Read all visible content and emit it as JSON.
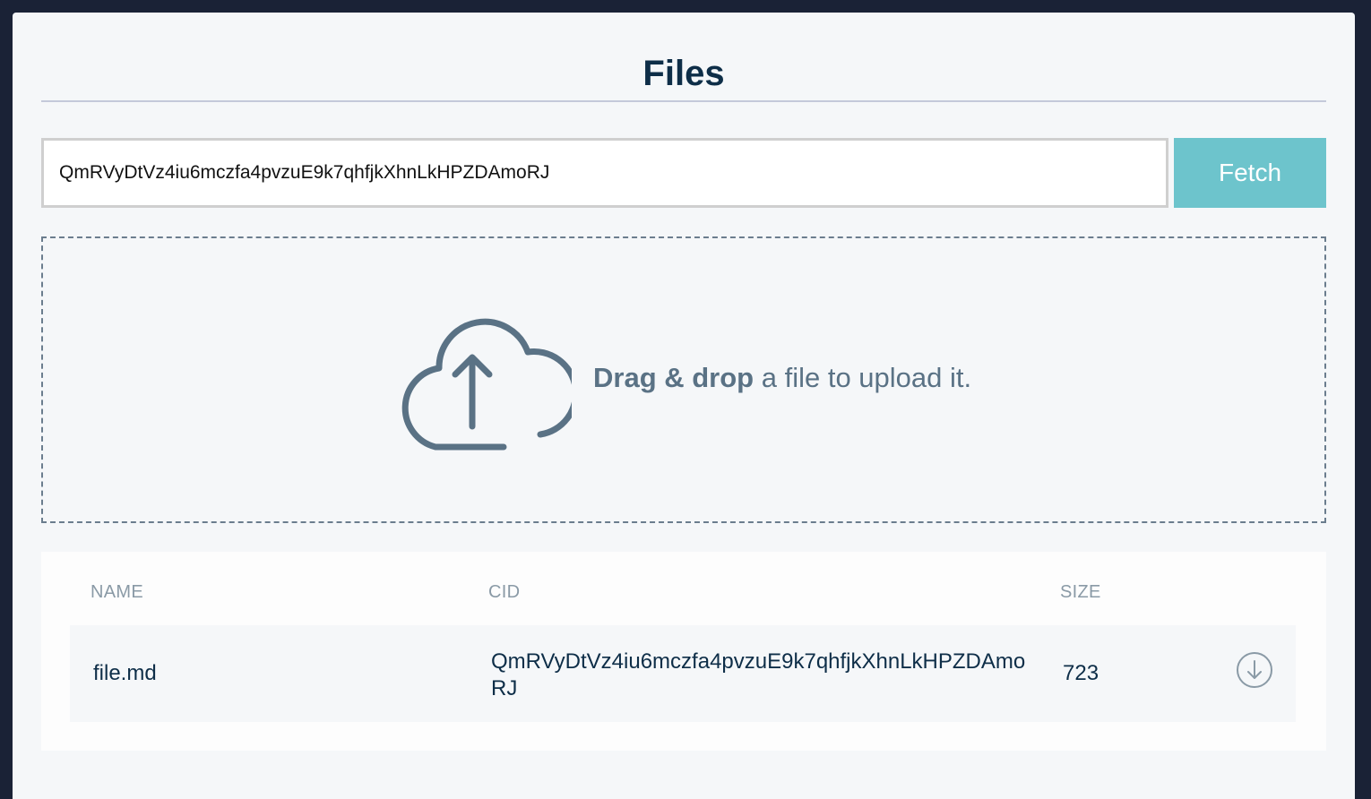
{
  "header": {
    "title": "Files"
  },
  "fetch": {
    "cid_value": "QmRVyDtVz4iu6mczfa4pvzuE9k7qhfjkXhnLkHPZDAmoRJ",
    "button_label": "Fetch"
  },
  "dropzone": {
    "icon": "cloud-upload-icon",
    "bold_text": "Drag & drop",
    "rest_text": " a file to upload it."
  },
  "table": {
    "columns": [
      "NAME",
      "CID",
      "SIZE"
    ],
    "rows": [
      {
        "name": "file.md",
        "cid": "QmRVyDtVz4iu6mczfa4pvzuE9k7qhfjkXhnLkHPZDAmoRJ",
        "size": "723",
        "action_icon": "download-icon"
      }
    ]
  },
  "colors": {
    "background": "#1a2236",
    "panel": "#f5f7f9",
    "title": "#0e2e48",
    "accent": "#6dc4cc",
    "muted": "#5a7285"
  }
}
